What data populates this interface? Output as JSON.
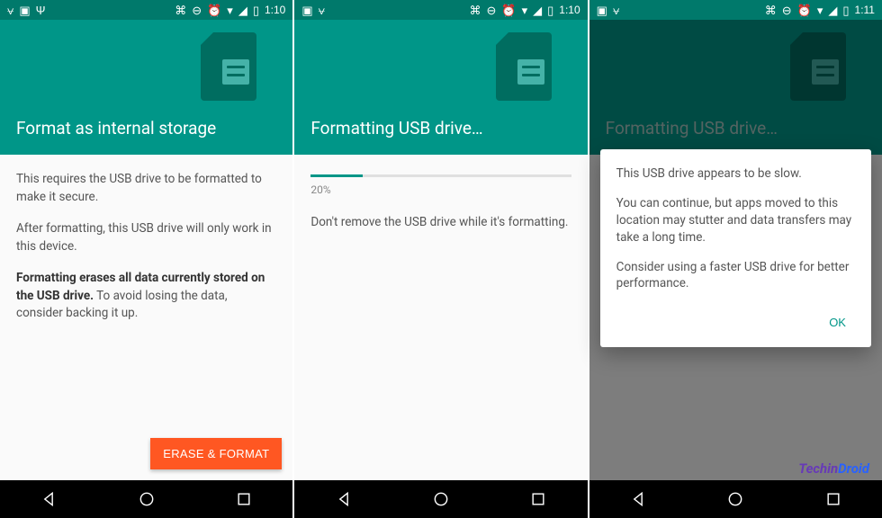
{
  "screens": [
    {
      "status": {
        "time": "1:10",
        "has_usb": true
      },
      "title": "Format as internal storage",
      "body": {
        "p1": "This requires the USB drive to be formatted to make it secure.",
        "p2": "After formatting, this USB drive will only work in this device.",
        "p3_bold": "Formatting erases all data currently stored on the USB drive.",
        "p3_rest": " To avoid losing the data, consider backing it up."
      },
      "action": "ERASE & FORMAT"
    },
    {
      "status": {
        "time": "1:10",
        "has_usb": false
      },
      "title": "Formatting USB drive…",
      "progress": {
        "percent": 20,
        "label": "20%"
      },
      "body": {
        "p1": "Don't remove the USB drive while it's formatting."
      }
    },
    {
      "status": {
        "time": "1:11",
        "has_usb": false
      },
      "title": "Formatting USB drive…",
      "dialog": {
        "p1": "This USB drive appears to be slow.",
        "p2": "You can continue, but apps moved to this location may stutter and data transfers may take a long time.",
        "p3": "Consider using a faster USB drive for better performance.",
        "ok": "OK"
      }
    }
  ],
  "watermark": {
    "a": "Techin",
    "b": "Droid"
  },
  "colors": {
    "primary": "#009688",
    "primary_dark": "#00796b",
    "accent": "#ff5722"
  }
}
